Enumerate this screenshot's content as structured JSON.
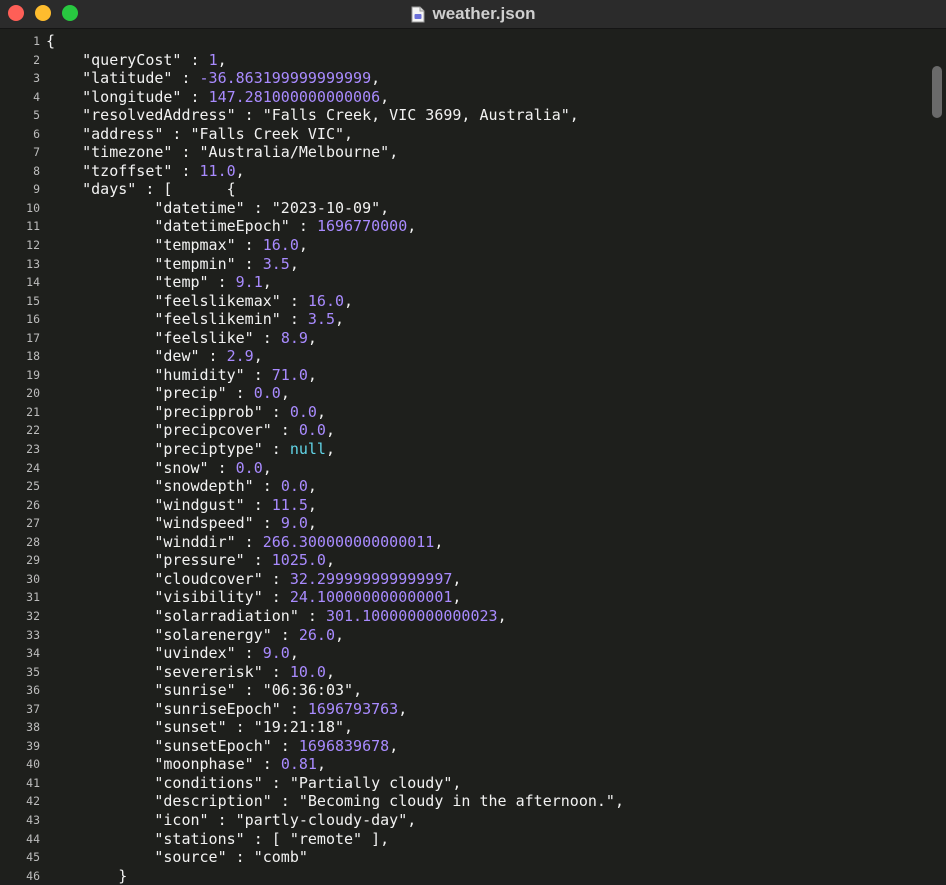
{
  "window": {
    "title": "weather.json"
  },
  "editor": {
    "lines": [
      {
        "n": "1",
        "tokens": [
          {
            "t": "{",
            "c": "p"
          }
        ]
      },
      {
        "n": "2",
        "tokens": [
          {
            "t": "    ",
            "c": "p"
          },
          {
            "t": "\"queryCost\"",
            "c": "key"
          },
          {
            "t": " : ",
            "c": "p"
          },
          {
            "t": "1",
            "c": "num"
          },
          {
            "t": ",",
            "c": "p"
          }
        ]
      },
      {
        "n": "3",
        "tokens": [
          {
            "t": "    ",
            "c": "p"
          },
          {
            "t": "\"latitude\"",
            "c": "key"
          },
          {
            "t": " : ",
            "c": "p"
          },
          {
            "t": "-36.863199999999999",
            "c": "num"
          },
          {
            "t": ",",
            "c": "p"
          }
        ]
      },
      {
        "n": "4",
        "tokens": [
          {
            "t": "    ",
            "c": "p"
          },
          {
            "t": "\"longitude\"",
            "c": "key"
          },
          {
            "t": " : ",
            "c": "p"
          },
          {
            "t": "147.281000000000006",
            "c": "num"
          },
          {
            "t": ",",
            "c": "p"
          }
        ]
      },
      {
        "n": "5",
        "tokens": [
          {
            "t": "    ",
            "c": "p"
          },
          {
            "t": "\"resolvedAddress\"",
            "c": "key"
          },
          {
            "t": " : ",
            "c": "p"
          },
          {
            "t": "\"Falls Creek, VIC 3699, Australia\"",
            "c": "str"
          },
          {
            "t": ",",
            "c": "p"
          }
        ]
      },
      {
        "n": "6",
        "tokens": [
          {
            "t": "    ",
            "c": "p"
          },
          {
            "t": "\"address\"",
            "c": "key"
          },
          {
            "t": " : ",
            "c": "p"
          },
          {
            "t": "\"Falls Creek VIC\"",
            "c": "str"
          },
          {
            "t": ",",
            "c": "p"
          }
        ]
      },
      {
        "n": "7",
        "tokens": [
          {
            "t": "    ",
            "c": "p"
          },
          {
            "t": "\"timezone\"",
            "c": "key"
          },
          {
            "t": " : ",
            "c": "p"
          },
          {
            "t": "\"Australia/Melbourne\"",
            "c": "str"
          },
          {
            "t": ",",
            "c": "p"
          }
        ]
      },
      {
        "n": "8",
        "tokens": [
          {
            "t": "    ",
            "c": "p"
          },
          {
            "t": "\"tzoffset\"",
            "c": "key"
          },
          {
            "t": " : ",
            "c": "p"
          },
          {
            "t": "11.0",
            "c": "num"
          },
          {
            "t": ",",
            "c": "p"
          }
        ]
      },
      {
        "n": "9",
        "tokens": [
          {
            "t": "    ",
            "c": "p"
          },
          {
            "t": "\"days\"",
            "c": "key"
          },
          {
            "t": " : [      {",
            "c": "p"
          }
        ]
      },
      {
        "n": "10",
        "tokens": [
          {
            "t": "            ",
            "c": "p"
          },
          {
            "t": "\"datetime\"",
            "c": "key"
          },
          {
            "t": " : ",
            "c": "p"
          },
          {
            "t": "\"2023-10-09\"",
            "c": "str"
          },
          {
            "t": ",",
            "c": "p"
          }
        ]
      },
      {
        "n": "11",
        "tokens": [
          {
            "t": "            ",
            "c": "p"
          },
          {
            "t": "\"datetimeEpoch\"",
            "c": "key"
          },
          {
            "t": " : ",
            "c": "p"
          },
          {
            "t": "1696770000",
            "c": "num"
          },
          {
            "t": ",",
            "c": "p"
          }
        ]
      },
      {
        "n": "12",
        "tokens": [
          {
            "t": "            ",
            "c": "p"
          },
          {
            "t": "\"tempmax\"",
            "c": "key"
          },
          {
            "t": " : ",
            "c": "p"
          },
          {
            "t": "16.0",
            "c": "num"
          },
          {
            "t": ",",
            "c": "p"
          }
        ]
      },
      {
        "n": "13",
        "tokens": [
          {
            "t": "            ",
            "c": "p"
          },
          {
            "t": "\"tempmin\"",
            "c": "key"
          },
          {
            "t": " : ",
            "c": "p"
          },
          {
            "t": "3.5",
            "c": "num"
          },
          {
            "t": ",",
            "c": "p"
          }
        ]
      },
      {
        "n": "14",
        "tokens": [
          {
            "t": "            ",
            "c": "p"
          },
          {
            "t": "\"temp\"",
            "c": "key"
          },
          {
            "t": " : ",
            "c": "p"
          },
          {
            "t": "9.1",
            "c": "num"
          },
          {
            "t": ",",
            "c": "p"
          }
        ]
      },
      {
        "n": "15",
        "tokens": [
          {
            "t": "            ",
            "c": "p"
          },
          {
            "t": "\"feelslikemax\"",
            "c": "key"
          },
          {
            "t": " : ",
            "c": "p"
          },
          {
            "t": "16.0",
            "c": "num"
          },
          {
            "t": ",",
            "c": "p"
          }
        ]
      },
      {
        "n": "16",
        "tokens": [
          {
            "t": "            ",
            "c": "p"
          },
          {
            "t": "\"feelslikemin\"",
            "c": "key"
          },
          {
            "t": " : ",
            "c": "p"
          },
          {
            "t": "3.5",
            "c": "num"
          },
          {
            "t": ",",
            "c": "p"
          }
        ]
      },
      {
        "n": "17",
        "tokens": [
          {
            "t": "            ",
            "c": "p"
          },
          {
            "t": "\"feelslike\"",
            "c": "key"
          },
          {
            "t": " : ",
            "c": "p"
          },
          {
            "t": "8.9",
            "c": "num"
          },
          {
            "t": ",",
            "c": "p"
          }
        ]
      },
      {
        "n": "18",
        "tokens": [
          {
            "t": "            ",
            "c": "p"
          },
          {
            "t": "\"dew\"",
            "c": "key"
          },
          {
            "t": " : ",
            "c": "p"
          },
          {
            "t": "2.9",
            "c": "num"
          },
          {
            "t": ",",
            "c": "p"
          }
        ]
      },
      {
        "n": "19",
        "tokens": [
          {
            "t": "            ",
            "c": "p"
          },
          {
            "t": "\"humidity\"",
            "c": "key"
          },
          {
            "t": " : ",
            "c": "p"
          },
          {
            "t": "71.0",
            "c": "num"
          },
          {
            "t": ",",
            "c": "p"
          }
        ]
      },
      {
        "n": "20",
        "tokens": [
          {
            "t": "            ",
            "c": "p"
          },
          {
            "t": "\"precip\"",
            "c": "key"
          },
          {
            "t": " : ",
            "c": "p"
          },
          {
            "t": "0.0",
            "c": "num"
          },
          {
            "t": ",",
            "c": "p"
          }
        ]
      },
      {
        "n": "21",
        "tokens": [
          {
            "t": "            ",
            "c": "p"
          },
          {
            "t": "\"precipprob\"",
            "c": "key"
          },
          {
            "t": " : ",
            "c": "p"
          },
          {
            "t": "0.0",
            "c": "num"
          },
          {
            "t": ",",
            "c": "p"
          }
        ]
      },
      {
        "n": "22",
        "tokens": [
          {
            "t": "            ",
            "c": "p"
          },
          {
            "t": "\"precipcover\"",
            "c": "key"
          },
          {
            "t": " : ",
            "c": "p"
          },
          {
            "t": "0.0",
            "c": "num"
          },
          {
            "t": ",",
            "c": "p"
          }
        ]
      },
      {
        "n": "23",
        "tokens": [
          {
            "t": "            ",
            "c": "p"
          },
          {
            "t": "\"preciptype\"",
            "c": "key"
          },
          {
            "t": " : ",
            "c": "p"
          },
          {
            "t": "null",
            "c": "nul"
          },
          {
            "t": ",",
            "c": "p"
          }
        ]
      },
      {
        "n": "24",
        "tokens": [
          {
            "t": "            ",
            "c": "p"
          },
          {
            "t": "\"snow\"",
            "c": "key"
          },
          {
            "t": " : ",
            "c": "p"
          },
          {
            "t": "0.0",
            "c": "num"
          },
          {
            "t": ",",
            "c": "p"
          }
        ]
      },
      {
        "n": "25",
        "tokens": [
          {
            "t": "            ",
            "c": "p"
          },
          {
            "t": "\"snowdepth\"",
            "c": "key"
          },
          {
            "t": " : ",
            "c": "p"
          },
          {
            "t": "0.0",
            "c": "num"
          },
          {
            "t": ",",
            "c": "p"
          }
        ]
      },
      {
        "n": "26",
        "tokens": [
          {
            "t": "            ",
            "c": "p"
          },
          {
            "t": "\"windgust\"",
            "c": "key"
          },
          {
            "t": " : ",
            "c": "p"
          },
          {
            "t": "11.5",
            "c": "num"
          },
          {
            "t": ",",
            "c": "p"
          }
        ]
      },
      {
        "n": "27",
        "tokens": [
          {
            "t": "            ",
            "c": "p"
          },
          {
            "t": "\"windspeed\"",
            "c": "key"
          },
          {
            "t": " : ",
            "c": "p"
          },
          {
            "t": "9.0",
            "c": "num"
          },
          {
            "t": ",",
            "c": "p"
          }
        ]
      },
      {
        "n": "28",
        "tokens": [
          {
            "t": "            ",
            "c": "p"
          },
          {
            "t": "\"winddir\"",
            "c": "key"
          },
          {
            "t": " : ",
            "c": "p"
          },
          {
            "t": "266.300000000000011",
            "c": "num"
          },
          {
            "t": ",",
            "c": "p"
          }
        ]
      },
      {
        "n": "29",
        "tokens": [
          {
            "t": "            ",
            "c": "p"
          },
          {
            "t": "\"pressure\"",
            "c": "key"
          },
          {
            "t": " : ",
            "c": "p"
          },
          {
            "t": "1025.0",
            "c": "num"
          },
          {
            "t": ",",
            "c": "p"
          }
        ]
      },
      {
        "n": "30",
        "tokens": [
          {
            "t": "            ",
            "c": "p"
          },
          {
            "t": "\"cloudcover\"",
            "c": "key"
          },
          {
            "t": " : ",
            "c": "p"
          },
          {
            "t": "32.299999999999997",
            "c": "num"
          },
          {
            "t": ",",
            "c": "p"
          }
        ]
      },
      {
        "n": "31",
        "tokens": [
          {
            "t": "            ",
            "c": "p"
          },
          {
            "t": "\"visibility\"",
            "c": "key"
          },
          {
            "t": " : ",
            "c": "p"
          },
          {
            "t": "24.100000000000001",
            "c": "num"
          },
          {
            "t": ",",
            "c": "p"
          }
        ]
      },
      {
        "n": "32",
        "tokens": [
          {
            "t": "            ",
            "c": "p"
          },
          {
            "t": "\"solarradiation\"",
            "c": "key"
          },
          {
            "t": " : ",
            "c": "p"
          },
          {
            "t": "301.100000000000023",
            "c": "num"
          },
          {
            "t": ",",
            "c": "p"
          }
        ]
      },
      {
        "n": "33",
        "tokens": [
          {
            "t": "            ",
            "c": "p"
          },
          {
            "t": "\"solarenergy\"",
            "c": "key"
          },
          {
            "t": " : ",
            "c": "p"
          },
          {
            "t": "26.0",
            "c": "num"
          },
          {
            "t": ",",
            "c": "p"
          }
        ]
      },
      {
        "n": "34",
        "tokens": [
          {
            "t": "            ",
            "c": "p"
          },
          {
            "t": "\"uvindex\"",
            "c": "key"
          },
          {
            "t": " : ",
            "c": "p"
          },
          {
            "t": "9.0",
            "c": "num"
          },
          {
            "t": ",",
            "c": "p"
          }
        ]
      },
      {
        "n": "35",
        "tokens": [
          {
            "t": "            ",
            "c": "p"
          },
          {
            "t": "\"severerisk\"",
            "c": "key"
          },
          {
            "t": " : ",
            "c": "p"
          },
          {
            "t": "10.0",
            "c": "num"
          },
          {
            "t": ",",
            "c": "p"
          }
        ]
      },
      {
        "n": "36",
        "tokens": [
          {
            "t": "            ",
            "c": "p"
          },
          {
            "t": "\"sunrise\"",
            "c": "key"
          },
          {
            "t": " : ",
            "c": "p"
          },
          {
            "t": "\"06:36:03\"",
            "c": "str"
          },
          {
            "t": ",",
            "c": "p"
          }
        ]
      },
      {
        "n": "37",
        "tokens": [
          {
            "t": "            ",
            "c": "p"
          },
          {
            "t": "\"sunriseEpoch\"",
            "c": "key"
          },
          {
            "t": " : ",
            "c": "p"
          },
          {
            "t": "1696793763",
            "c": "num"
          },
          {
            "t": ",",
            "c": "p"
          }
        ]
      },
      {
        "n": "38",
        "tokens": [
          {
            "t": "            ",
            "c": "p"
          },
          {
            "t": "\"sunset\"",
            "c": "key"
          },
          {
            "t": " : ",
            "c": "p"
          },
          {
            "t": "\"19:21:18\"",
            "c": "str"
          },
          {
            "t": ",",
            "c": "p"
          }
        ]
      },
      {
        "n": "39",
        "tokens": [
          {
            "t": "            ",
            "c": "p"
          },
          {
            "t": "\"sunsetEpoch\"",
            "c": "key"
          },
          {
            "t": " : ",
            "c": "p"
          },
          {
            "t": "1696839678",
            "c": "num"
          },
          {
            "t": ",",
            "c": "p"
          }
        ]
      },
      {
        "n": "40",
        "tokens": [
          {
            "t": "            ",
            "c": "p"
          },
          {
            "t": "\"moonphase\"",
            "c": "key"
          },
          {
            "t": " : ",
            "c": "p"
          },
          {
            "t": "0.81",
            "c": "num"
          },
          {
            "t": ",",
            "c": "p"
          }
        ]
      },
      {
        "n": "41",
        "tokens": [
          {
            "t": "            ",
            "c": "p"
          },
          {
            "t": "\"conditions\"",
            "c": "key"
          },
          {
            "t": " : ",
            "c": "p"
          },
          {
            "t": "\"Partially cloudy\"",
            "c": "str"
          },
          {
            "t": ",",
            "c": "p"
          }
        ]
      },
      {
        "n": "42",
        "tokens": [
          {
            "t": "            ",
            "c": "p"
          },
          {
            "t": "\"description\"",
            "c": "key"
          },
          {
            "t": " : ",
            "c": "p"
          },
          {
            "t": "\"Becoming cloudy in the afternoon.\"",
            "c": "str"
          },
          {
            "t": ",",
            "c": "p"
          }
        ]
      },
      {
        "n": "43",
        "tokens": [
          {
            "t": "            ",
            "c": "p"
          },
          {
            "t": "\"icon\"",
            "c": "key"
          },
          {
            "t": " : ",
            "c": "p"
          },
          {
            "t": "\"partly-cloudy-day\"",
            "c": "str"
          },
          {
            "t": ",",
            "c": "p"
          }
        ]
      },
      {
        "n": "44",
        "tokens": [
          {
            "t": "            ",
            "c": "p"
          },
          {
            "t": "\"stations\"",
            "c": "key"
          },
          {
            "t": " : [ ",
            "c": "p"
          },
          {
            "t": "\"remote\"",
            "c": "str"
          },
          {
            "t": " ],",
            "c": "p"
          }
        ]
      },
      {
        "n": "45",
        "tokens": [
          {
            "t": "            ",
            "c": "p"
          },
          {
            "t": "\"source\"",
            "c": "key"
          },
          {
            "t": " : ",
            "c": "p"
          },
          {
            "t": "\"comb\"",
            "c": "str"
          }
        ]
      },
      {
        "n": "46",
        "tokens": [
          {
            "t": "        }",
            "c": "p"
          }
        ]
      }
    ]
  }
}
